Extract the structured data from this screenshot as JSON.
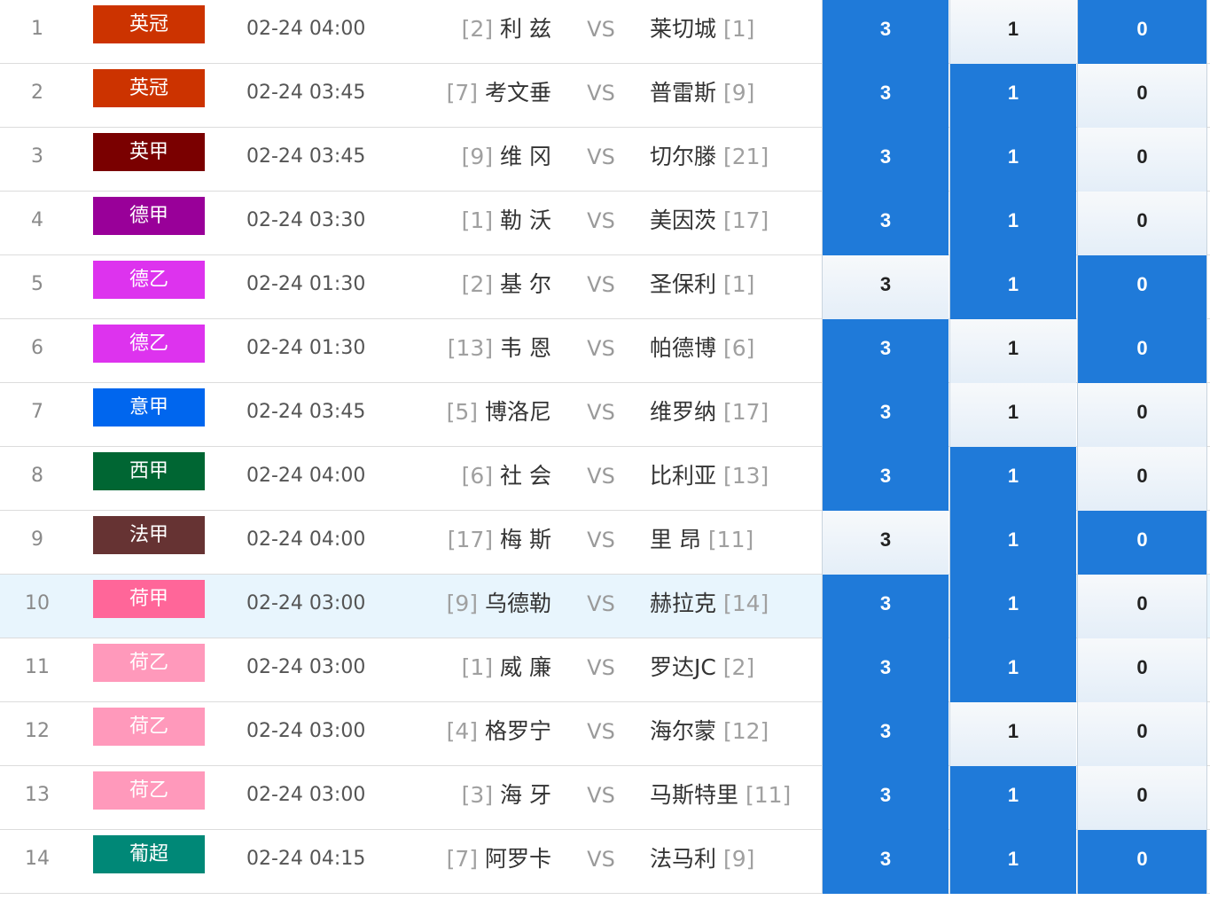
{
  "colors": {
    "selected_bg": "#1f7ad9",
    "selected_fg": "#ffffff",
    "unselected_fg": "#222222",
    "highlight_row_bg": "#e8f5fd"
  },
  "vs_label": "VS",
  "matches": [
    {
      "index": "1",
      "league": "英冠",
      "league_color": "#cc3300",
      "time": "02-24 04:00",
      "home_rank": "[2]",
      "home": "利 兹",
      "away": "莱切城",
      "away_rank": "[1]",
      "options": [
        "3",
        "1",
        "0"
      ],
      "selected": [
        true,
        false,
        true
      ],
      "highlight": false
    },
    {
      "index": "2",
      "league": "英冠",
      "league_color": "#cc3300",
      "time": "02-24 03:45",
      "home_rank": "[7]",
      "home": "考文垂",
      "away": "普雷斯",
      "away_rank": "[9]",
      "options": [
        "3",
        "1",
        "0"
      ],
      "selected": [
        true,
        true,
        false
      ],
      "highlight": false
    },
    {
      "index": "3",
      "league": "英甲",
      "league_color": "#7a0000",
      "time": "02-24 03:45",
      "home_rank": "[9]",
      "home": "维 冈",
      "away": "切尔滕",
      "away_rank": "[21]",
      "options": [
        "3",
        "1",
        "0"
      ],
      "selected": [
        true,
        true,
        false
      ],
      "highlight": false
    },
    {
      "index": "4",
      "league": "德甲",
      "league_color": "#990099",
      "time": "02-24 03:30",
      "home_rank": "[1]",
      "home": "勒 沃",
      "away": "美因茨",
      "away_rank": "[17]",
      "options": [
        "3",
        "1",
        "0"
      ],
      "selected": [
        true,
        true,
        false
      ],
      "highlight": false
    },
    {
      "index": "5",
      "league": "德乙",
      "league_color": "#dd33ee",
      "time": "02-24 01:30",
      "home_rank": "[2]",
      "home": "基 尔",
      "away": "圣保利",
      "away_rank": "[1]",
      "options": [
        "3",
        "1",
        "0"
      ],
      "selected": [
        false,
        true,
        true
      ],
      "highlight": false
    },
    {
      "index": "6",
      "league": "德乙",
      "league_color": "#dd33ee",
      "time": "02-24 01:30",
      "home_rank": "[13]",
      "home": "韦 恩",
      "away": "帕德博",
      "away_rank": "[6]",
      "options": [
        "3",
        "1",
        "0"
      ],
      "selected": [
        true,
        false,
        true
      ],
      "highlight": false
    },
    {
      "index": "7",
      "league": "意甲",
      "league_color": "#0066ee",
      "time": "02-24 03:45",
      "home_rank": "[5]",
      "home": "博洛尼",
      "away": "维罗纳",
      "away_rank": "[17]",
      "options": [
        "3",
        "1",
        "0"
      ],
      "selected": [
        true,
        false,
        false
      ],
      "highlight": false
    },
    {
      "index": "8",
      "league": "西甲",
      "league_color": "#006633",
      "time": "02-24 04:00",
      "home_rank": "[6]",
      "home": "社 会",
      "away": "比利亚",
      "away_rank": "[13]",
      "options": [
        "3",
        "1",
        "0"
      ],
      "selected": [
        true,
        true,
        false
      ],
      "highlight": false
    },
    {
      "index": "9",
      "league": "法甲",
      "league_color": "#663333",
      "time": "02-24 04:00",
      "home_rank": "[17]",
      "home": "梅 斯",
      "away": "里 昂",
      "away_rank": "[11]",
      "options": [
        "3",
        "1",
        "0"
      ],
      "selected": [
        false,
        true,
        true
      ],
      "highlight": false
    },
    {
      "index": "10",
      "league": "荷甲",
      "league_color": "#ff6699",
      "time": "02-24 03:00",
      "home_rank": "[9]",
      "home": "乌德勒",
      "away": "赫拉克",
      "away_rank": "[14]",
      "options": [
        "3",
        "1",
        "0"
      ],
      "selected": [
        true,
        true,
        false
      ],
      "highlight": true
    },
    {
      "index": "11",
      "league": "荷乙",
      "league_color": "#ff99bb",
      "time": "02-24 03:00",
      "home_rank": "[1]",
      "home": "威 廉",
      "away": "罗达JC",
      "away_rank": "[2]",
      "options": [
        "3",
        "1",
        "0"
      ],
      "selected": [
        true,
        true,
        false
      ],
      "highlight": false
    },
    {
      "index": "12",
      "league": "荷乙",
      "league_color": "#ff99bb",
      "time": "02-24 03:00",
      "home_rank": "[4]",
      "home": "格罗宁",
      "away": "海尔蒙",
      "away_rank": "[12]",
      "options": [
        "3",
        "1",
        "0"
      ],
      "selected": [
        true,
        false,
        false
      ],
      "highlight": false
    },
    {
      "index": "13",
      "league": "荷乙",
      "league_color": "#ff99bb",
      "time": "02-24 03:00",
      "home_rank": "[3]",
      "home": "海 牙",
      "away": "马斯特里",
      "away_rank": "[11]",
      "options": [
        "3",
        "1",
        "0"
      ],
      "selected": [
        true,
        true,
        false
      ],
      "highlight": false
    },
    {
      "index": "14",
      "league": "葡超",
      "league_color": "#008877",
      "time": "02-24 04:15",
      "home_rank": "[7]",
      "home": "阿罗卡",
      "away": "法马利",
      "away_rank": "[9]",
      "options": [
        "3",
        "1",
        "0"
      ],
      "selected": [
        true,
        true,
        true
      ],
      "highlight": false
    }
  ]
}
